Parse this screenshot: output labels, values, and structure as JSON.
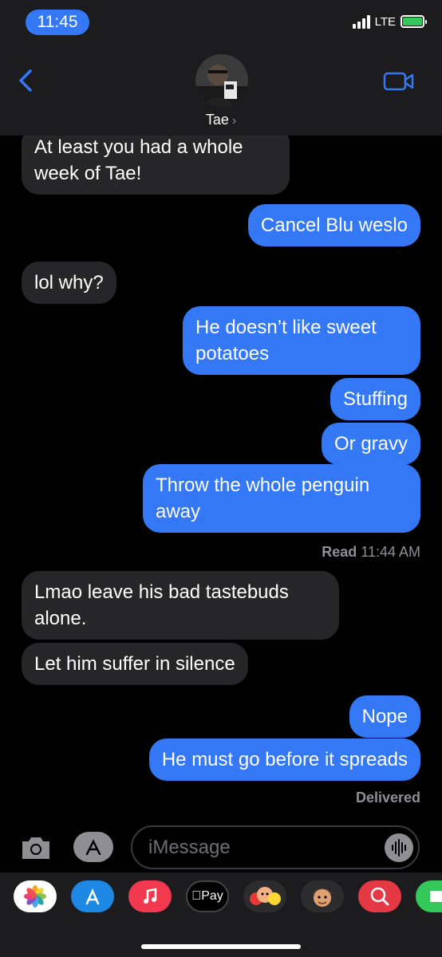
{
  "status_bar": {
    "time": "11:45",
    "network": "LTE"
  },
  "header": {
    "contact_name": "Tae",
    "contact_chevron": "›"
  },
  "messages": [
    {
      "side": "in",
      "text": "At least you had a whole week of Tae!"
    },
    {
      "side": "out",
      "text": "Cancel Blu weslo"
    },
    {
      "side": "in",
      "text": "lol why?"
    },
    {
      "side": "out",
      "text": "He doesn’t like sweet potatoes"
    },
    {
      "side": "out",
      "text": "Stuffing"
    },
    {
      "side": "out",
      "text": "Or gravy"
    },
    {
      "side": "out",
      "text": "Throw the whole penguin away"
    },
    {
      "side": "in",
      "text": "Lmao leave his bad tastebuds alone."
    },
    {
      "side": "in",
      "text": "Let him suffer in silence"
    },
    {
      "side": "out",
      "text": "Nope"
    },
    {
      "side": "out",
      "text": "He must go before it spreads"
    }
  ],
  "receipts": {
    "read_label": "Read",
    "read_time": "11:44 AM",
    "delivered": "Delivered"
  },
  "compose": {
    "placeholder": "iMessage"
  },
  "drawer": {
    "apple_pay_label": "Pay",
    "apps": [
      "photos-icon",
      "app-store-icon",
      "music-icon",
      "apple-pay-icon",
      "memoji-stickers-icon",
      "memoji-icon",
      "search-images-icon",
      "more-apps-icon"
    ]
  },
  "colors": {
    "outgoing_bubble": "#3478f6",
    "incoming_bubble": "#262628",
    "header_bg": "#1c1c1e",
    "time_pill": "#3478f6",
    "battery_fill": "#34c759"
  }
}
